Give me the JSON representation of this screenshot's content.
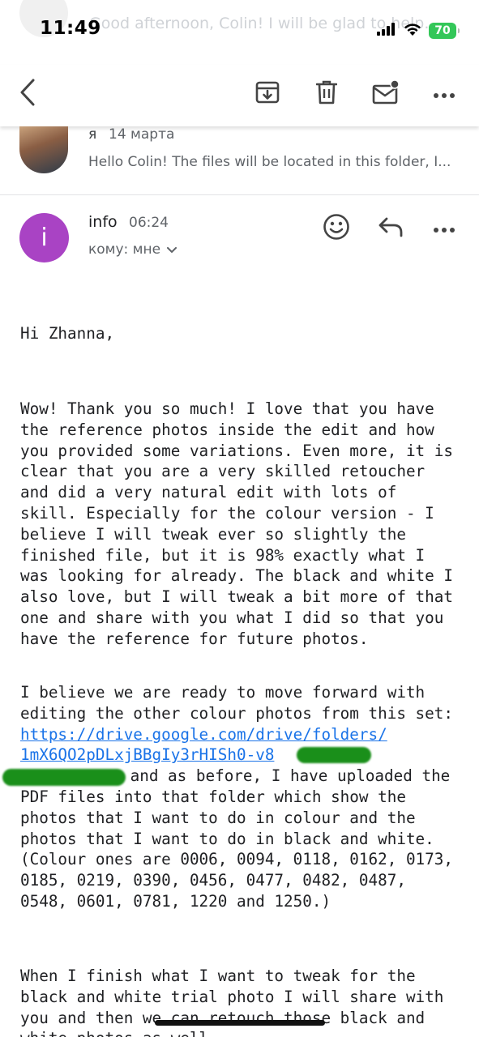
{
  "status_bar": {
    "time": "11:49",
    "battery": "70",
    "battery_color": "#34c759",
    "icons": [
      "signal-icon",
      "wifi-icon",
      "battery-icon"
    ]
  },
  "ghost_text": "Good afternoon, Colin! I will be glad to help...",
  "toolbar": {
    "icons": [
      "back-icon",
      "archive-icon",
      "trash-icon",
      "mark-unread-icon",
      "more-icon"
    ]
  },
  "previous_message": {
    "sender": "я",
    "date": "14 марта",
    "snippet": "Hello Colin! The files will be located in this folder, I..."
  },
  "message": {
    "avatar_letter": "i",
    "avatar_color": "#a943c4",
    "sender": "info",
    "time": "06:24",
    "recipient": "кому: мне",
    "actions": [
      "emoji-react-icon",
      "reply-icon",
      "more-icon"
    ]
  },
  "body": {
    "greeting": "Hi Zhanna,",
    "paragraph1": "Wow! Thank you so much! I love that you have the reference photos inside the edit and how you provided some variations. Even more, it is clear that you are a very skilled retoucher and did a very natural edit with lots of skill. Especially for the colour version - I believe I will tweak ever so slightly the finished file, but it is 98% exactly what I was looking for already. The black and white I also love, but I will tweak a bit more of that one and share with you what I did so that you have the reference for future photos.",
    "p2_intro": "I believe we are ready to move forward with editing the other colour photos from this set:",
    "link_line1": "https://drive.google.com/drive/folders/",
    "link_line2": "1mX6QO2pDLxjBBgIy3rHISh0-v8",
    "p2_rest_line1": " and as before, I have uploaded the",
    "p2_rest": "PDF files into that folder which show the photos that I want to do in colour and the photos that I want to do in black and white. (Colour ones are 0006, 0094, 0118, 0162, 0173, 0185, 0219, 0390, 0456, 0477, 0482, 0487, 0548, 0601, 0781, 1220 and 1250.)",
    "paragraph3": "When I finish what I want to tweak for the black and white trial photo I will share with you and then we can retouch those black and white photos as well."
  }
}
